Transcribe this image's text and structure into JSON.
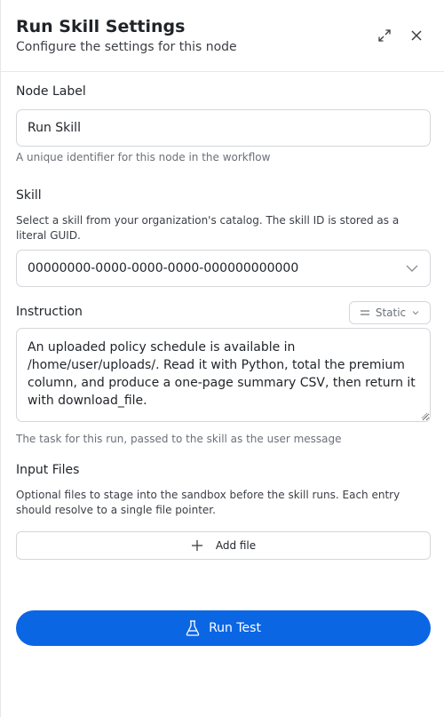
{
  "header": {
    "title": "Run Skill Settings",
    "subtitle": "Configure the settings for this node",
    "expand_icon": "expand-icon",
    "close_icon": "close-icon"
  },
  "node_label": {
    "label": "Node Label",
    "value": "Run Skill",
    "help": "A unique identifier for this node in the workflow"
  },
  "skill": {
    "label": "Skill",
    "description": "Select a skill from your organization's catalog. The skill ID is stored as a literal GUID.",
    "value": "00000000-0000-0000-0000-000000000000",
    "chevron_icon": "chevron-down-icon"
  },
  "instruction": {
    "label": "Instruction",
    "mode_label": "Static",
    "mode_icon": "equals-icon",
    "value": "An uploaded policy schedule is available in /home/user/uploads/. Read it with Python, total the premium column, and produce a one-page summary CSV, then return it with download_file.",
    "help": "The task for this run, passed to the skill as the user message"
  },
  "input_files": {
    "label": "Input Files",
    "description": "Optional files to stage into the sandbox before the skill runs. Each entry should resolve to a single file pointer.",
    "add_label": "Add file",
    "add_icon": "plus-icon"
  },
  "run_test": {
    "label": "Run Test",
    "icon": "flask-icon",
    "color": "#0b66e4"
  }
}
